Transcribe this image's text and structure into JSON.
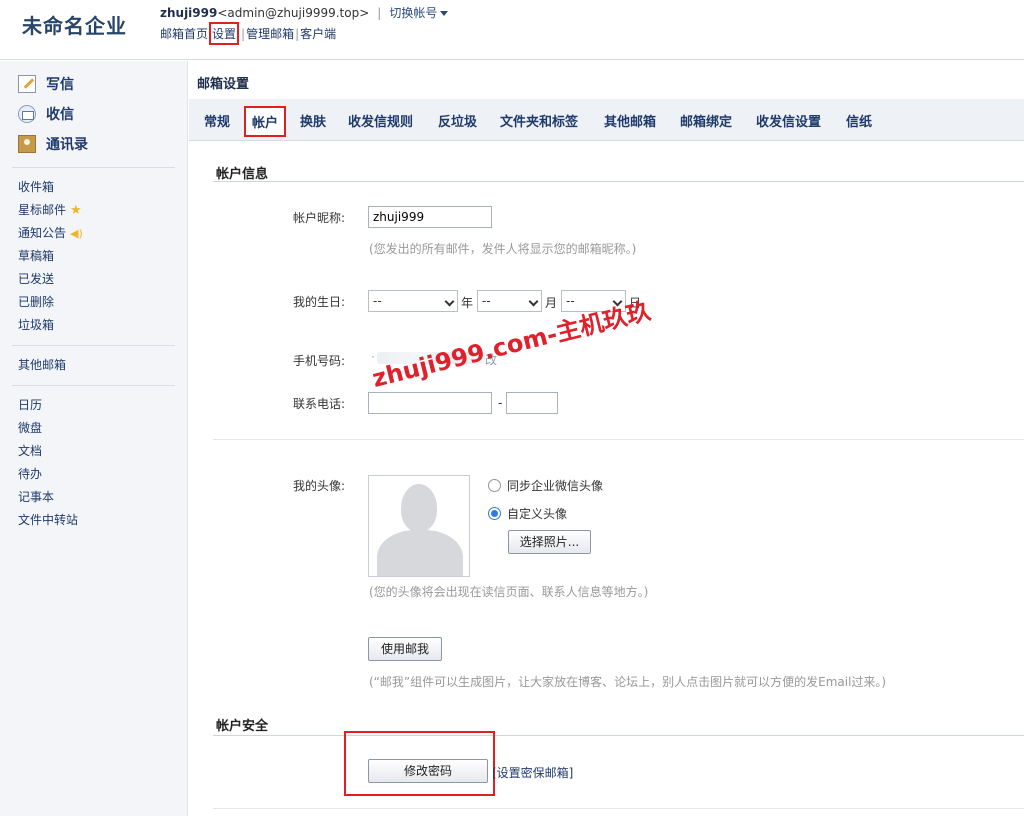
{
  "header": {
    "company": "未命名企业",
    "user_name": "zhuji999",
    "user_email": "<admin@zhuji9999.top>",
    "separator": "|",
    "switch_account": "切换帐号",
    "links": [
      "邮箱首页",
      "设置",
      "管理邮箱",
      "客户端"
    ]
  },
  "sidebar": {
    "actions": [
      {
        "label": "写信",
        "icon": "compose-icon"
      },
      {
        "label": "收信",
        "icon": "inbox-icon"
      },
      {
        "label": "通讯录",
        "icon": "contacts-icon"
      }
    ],
    "folders": [
      "收件箱",
      "星标邮件",
      "通知公告",
      "草稿箱",
      "已发送",
      "已删除",
      "垃圾箱"
    ],
    "other_mailbox": "其他邮箱",
    "apps": [
      "日历",
      "微盘",
      "文档",
      "待办",
      "记事本",
      "文件中转站"
    ]
  },
  "content": {
    "page_title": "邮箱设置",
    "tabs": [
      "常规",
      "帐户",
      "换肤",
      "收发信规则",
      "反垃圾",
      "文件夹和标签",
      "其他邮箱",
      "邮箱绑定",
      "收发信设置",
      "信纸"
    ],
    "active_tab": "帐户",
    "account_info": {
      "section_title": "帐户信息",
      "nickname_label": "帐户昵称:",
      "nickname_value": "zhuji999",
      "nickname_hint": "(您发出的所有邮件，发件人将显示您的邮箱昵称。)",
      "birthday_label": "我的生日:",
      "birthday_year": "--",
      "birthday_month": "--",
      "birthday_day": "--",
      "year_unit": "年",
      "month_unit": "月",
      "day_unit": "日",
      "mobile_label": "手机号码:",
      "mobile_partial_start": "·",
      "mobile_partial_end": "改",
      "phone_label": "联系电话:",
      "phone_dash": "-",
      "avatar_label": "我的头像:",
      "avatar_option_sync": "同步企业微信头像",
      "avatar_option_custom": "自定义头像",
      "avatar_selected": "自定义头像",
      "choose_photo": "选择照片...",
      "avatar_hint": "(您的头像将会出现在读信页面、联系人信息等地方。)",
      "mail_me_button": "使用邮我",
      "mail_me_hint": "(“邮我”组件可以生成图片，让大家放在博客、论坛上，别人点击图片就可以方便的发Email过来。)"
    },
    "account_security": {
      "section_title": "帐户安全",
      "change_password": "修改密码",
      "set_security_email": "[设置密保邮箱]"
    }
  },
  "watermark": "zhuji999.com-主机玖玖",
  "colors": {
    "highlight": "#e02020",
    "brand_text": "#27456a",
    "link": "#1f3a6b",
    "radio_selected": "#2f7ae5"
  }
}
